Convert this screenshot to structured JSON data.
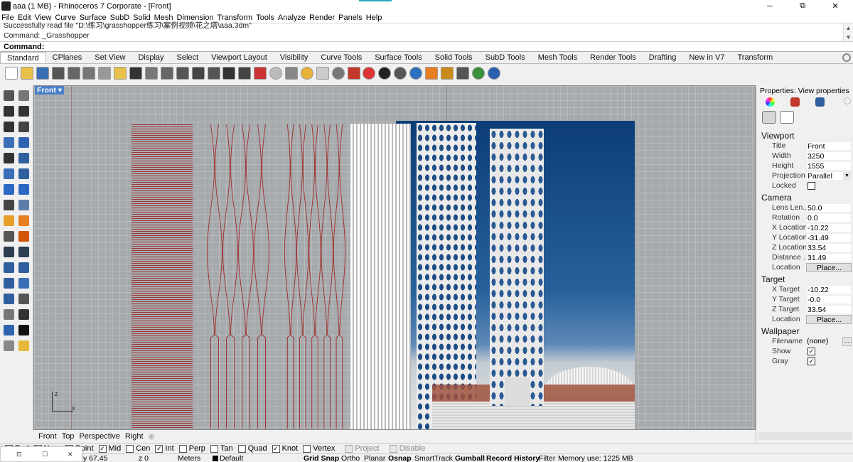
{
  "window": {
    "title": "aaa (1 MB) - Rhinoceros 7 Corporate - [Front]",
    "minimize": "─",
    "maximize": "⧉",
    "close": "✕"
  },
  "menu": [
    "File",
    "Edit",
    "View",
    "Curve",
    "Surface",
    "SubD",
    "Solid",
    "Mesh",
    "Dimension",
    "Transform",
    "Tools",
    "Analyze",
    "Render",
    "Panels",
    "Help"
  ],
  "command": {
    "history": [
      "Successfully read file \"D:\\练习\\grasshopper练习\\案例视频\\花之塔\\aaa.3dm\"",
      "Command: _Grasshopper"
    ],
    "prompt_label": "Command:"
  },
  "toolbar_tabs": [
    "Standard",
    "CPlanes",
    "Set View",
    "Display",
    "Select",
    "Viewport Layout",
    "Visibility",
    "Curve Tools",
    "Surface Tools",
    "Solid Tools",
    "SubD Tools",
    "Mesh Tools",
    "Render Tools",
    "Drafting",
    "New in V7",
    "Transform"
  ],
  "active_tab": "Standard",
  "toolbar_icons": [
    "new-file",
    "open-folder",
    "save",
    "print",
    "import",
    "cut",
    "copy",
    "paste",
    "undo",
    "pan",
    "move",
    "zoom-window",
    "zoom-extents",
    "zoom-selected",
    "rotate-view",
    "4-viewports",
    "car",
    "light-bulb",
    "ring-tool",
    "sun",
    "lamp",
    "torus",
    "material",
    "color-wheel",
    "sphere",
    "shaded-sphere",
    "globe",
    "flag",
    "gear-material",
    "grid-snap",
    "render-globe",
    "help"
  ],
  "viewport": {
    "label": "Front",
    "tabs": [
      "Front",
      "Top",
      "Perspective",
      "Right"
    ],
    "add_tab": "⊕",
    "axis_z": "z",
    "axis_x": "x"
  },
  "properties": {
    "title": "Properties: View properties",
    "viewport_section": "Viewport",
    "camera_section": "Camera",
    "target_section": "Target",
    "wallpaper_section": "Wallpaper",
    "viewport": [
      {
        "label": "Title",
        "value": "Front"
      },
      {
        "label": "Width",
        "value": "3250"
      },
      {
        "label": "Height",
        "value": "1555"
      },
      {
        "label": "Projection",
        "value": "Parallel"
      },
      {
        "label": "Locked",
        "value": ""
      }
    ],
    "camera": [
      {
        "label": "Lens Len...",
        "value": "50.0"
      },
      {
        "label": "Rotation",
        "value": "0.0"
      },
      {
        "label": "X Location",
        "value": "-10.22"
      },
      {
        "label": "Y Location",
        "value": "-31.49"
      },
      {
        "label": "Z Location",
        "value": "33.54"
      },
      {
        "label": "Distance ...",
        "value": "31.49"
      },
      {
        "label": "Location",
        "value": "Place..."
      }
    ],
    "target": [
      {
        "label": "X Target",
        "value": "-10.22"
      },
      {
        "label": "Y Target",
        "value": "-0.0"
      },
      {
        "label": "Z Target",
        "value": "33.54"
      },
      {
        "label": "Location",
        "value": "Place..."
      }
    ],
    "wallpaper": [
      {
        "label": "Filename",
        "value": "(none)"
      },
      {
        "label": "Show",
        "value": "✓"
      },
      {
        "label": "Gray",
        "value": "✓"
      }
    ],
    "browse": "..."
  },
  "osnap": [
    {
      "label": "End",
      "checked": true
    },
    {
      "label": "Near",
      "checked": true
    },
    {
      "label": "Point",
      "checked": true
    },
    {
      "label": "Mid",
      "checked": true
    },
    {
      "label": "Cen",
      "checked": false
    },
    {
      "label": "Int",
      "checked": true
    },
    {
      "label": "Perp",
      "checked": false
    },
    {
      "label": "Tan",
      "checked": false
    },
    {
      "label": "Quad",
      "checked": false
    },
    {
      "label": "Knot",
      "checked": true
    },
    {
      "label": "Vertex",
      "checked": false
    },
    {
      "label": "Project",
      "checked": false
    },
    {
      "label": "Disable",
      "checked": false
    }
  ],
  "status": {
    "y": "y 67.45",
    "z": "z 0",
    "units": "Meters",
    "layer": "Default",
    "grid_snap": "Grid Snap",
    "ortho": "Ortho",
    "planar": "Planar",
    "osnap": "Osnap",
    "smarttrack": "SmartTrack",
    "gumball": "Gumball",
    "record_history": "Record History",
    "filter": "Filter",
    "memory": "Memory use: 1225 MB"
  },
  "popup": {
    "a": "⊡",
    "b": "☐",
    "c": "✕"
  },
  "colors": {
    "accent": "#4a7fc8",
    "curve_red": "#a02a2a",
    "sky": "#1c4f8a",
    "grid": "#a6aaad"
  }
}
